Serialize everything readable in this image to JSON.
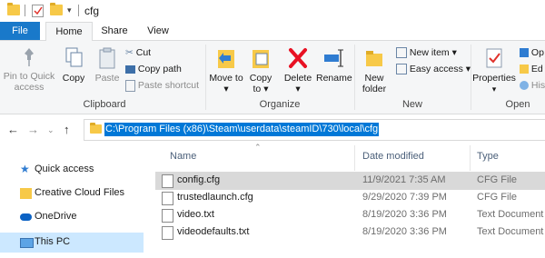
{
  "title_bar": {
    "title": "cfg"
  },
  "ribbon_tabs": {
    "file": "File",
    "home": "Home",
    "share": "Share",
    "view": "View"
  },
  "clipboard": {
    "pin": "Pin to Quick access",
    "copy": "Copy",
    "paste": "Paste",
    "cut": "Cut",
    "copy_path": "Copy path",
    "paste_shortcut": "Paste shortcut",
    "group": "Clipboard"
  },
  "organize": {
    "move_to": "Move to",
    "copy_to": "Copy to",
    "delete": "Delete",
    "rename": "Rename",
    "group": "Organize"
  },
  "new": {
    "new_folder": "New folder",
    "new_item": "New item",
    "easy_access": "Easy access",
    "group": "New"
  },
  "open": {
    "properties": "Properties",
    "op": "Op",
    "ed": "Ed",
    "his": "His",
    "group": "Open"
  },
  "address": {
    "path": "C:\\Program Files (x86)\\Steam\\userdata\\steamID\\730\\local\\cfg"
  },
  "navigation": {
    "items": [
      "Quick access",
      "Creative Cloud Files",
      "OneDrive",
      "This PC"
    ]
  },
  "columns": {
    "name": "Name",
    "date": "Date modified",
    "type": "Type"
  },
  "files": [
    {
      "name": "config.cfg",
      "date": "11/9/2021 7:35 AM",
      "type": "CFG File"
    },
    {
      "name": "trustedlaunch.cfg",
      "date": "9/29/2020 7:39 PM",
      "type": "CFG File"
    },
    {
      "name": "video.txt",
      "date": "8/19/2020 3:36 PM",
      "type": "Text Document"
    },
    {
      "name": "videodefaults.txt",
      "date": "8/19/2020 3:36 PM",
      "type": "Text Document"
    }
  ],
  "colors": {
    "accent": "#1979ca",
    "selection": "#0078d7",
    "nav_selected": "#cce8ff",
    "delete_red": "#e81123"
  }
}
